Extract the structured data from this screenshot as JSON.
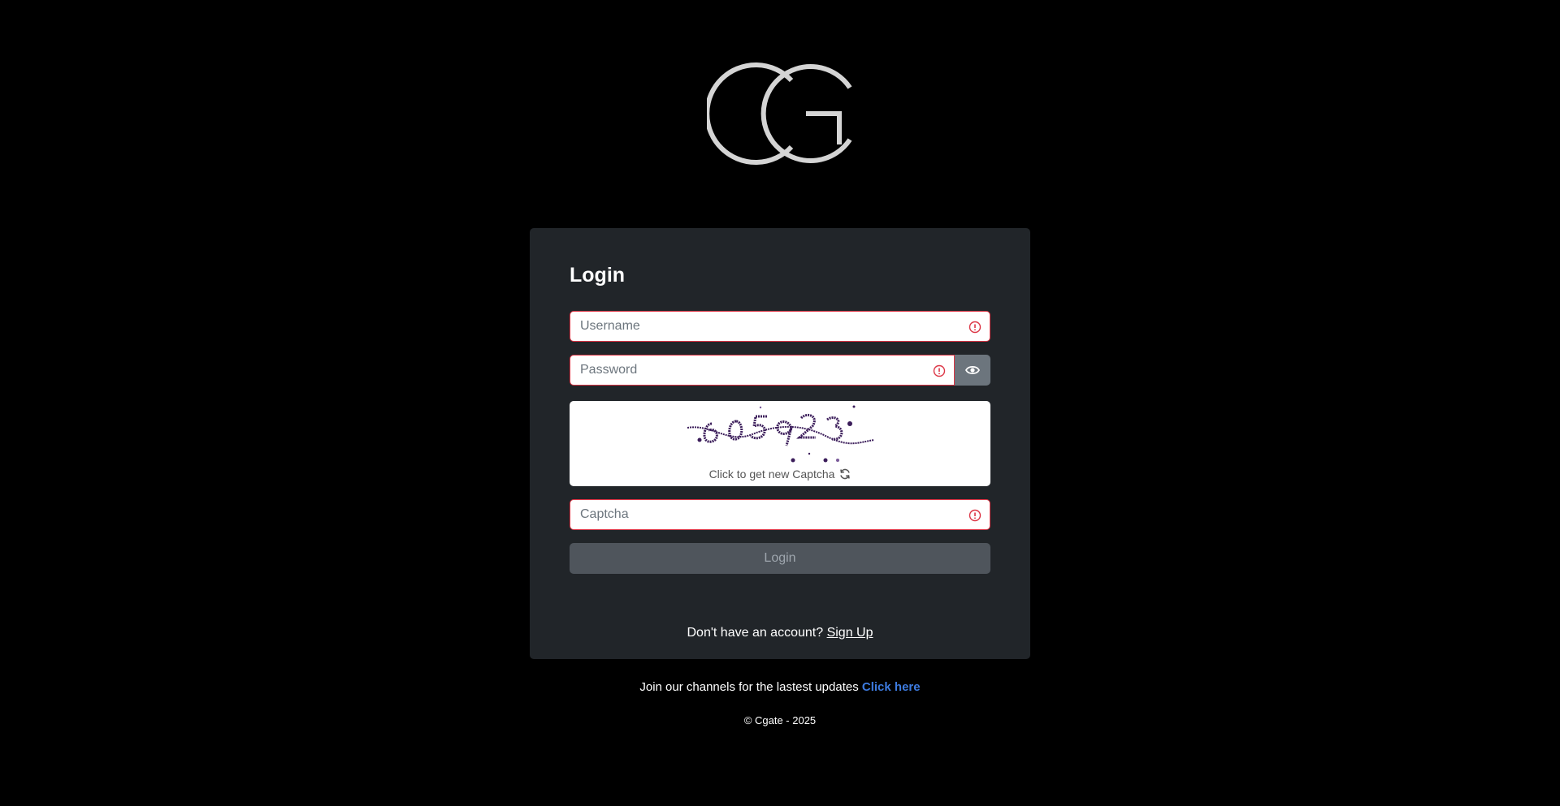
{
  "brand": {
    "logo_icon": "cg-monogram-logo",
    "logo_color": "#d4d4d4"
  },
  "login_form": {
    "title": "Login",
    "username": {
      "placeholder": "Username",
      "value": ""
    },
    "password": {
      "placeholder": "Password",
      "value": ""
    },
    "toggle_visibility_icon": "eye-icon",
    "captcha": {
      "refresh_label": "Click to get new Captcha",
      "refresh_icon": "refresh-icon",
      "input": {
        "placeholder": "Captcha",
        "value": ""
      }
    },
    "submit_label": "Login"
  },
  "signup": {
    "prompt": "Don't have an account?",
    "link_label": "Sign Up"
  },
  "channels": {
    "text": "Join our channels for the lastest updates",
    "link_label": "Click here"
  },
  "footer": {
    "copyright": "© Cgate - 2025"
  },
  "colors": {
    "background": "#000000",
    "card": "#212529",
    "invalid": "#dc3545",
    "link_accent": "#3d7be0",
    "button_disabled": "#545b62"
  }
}
